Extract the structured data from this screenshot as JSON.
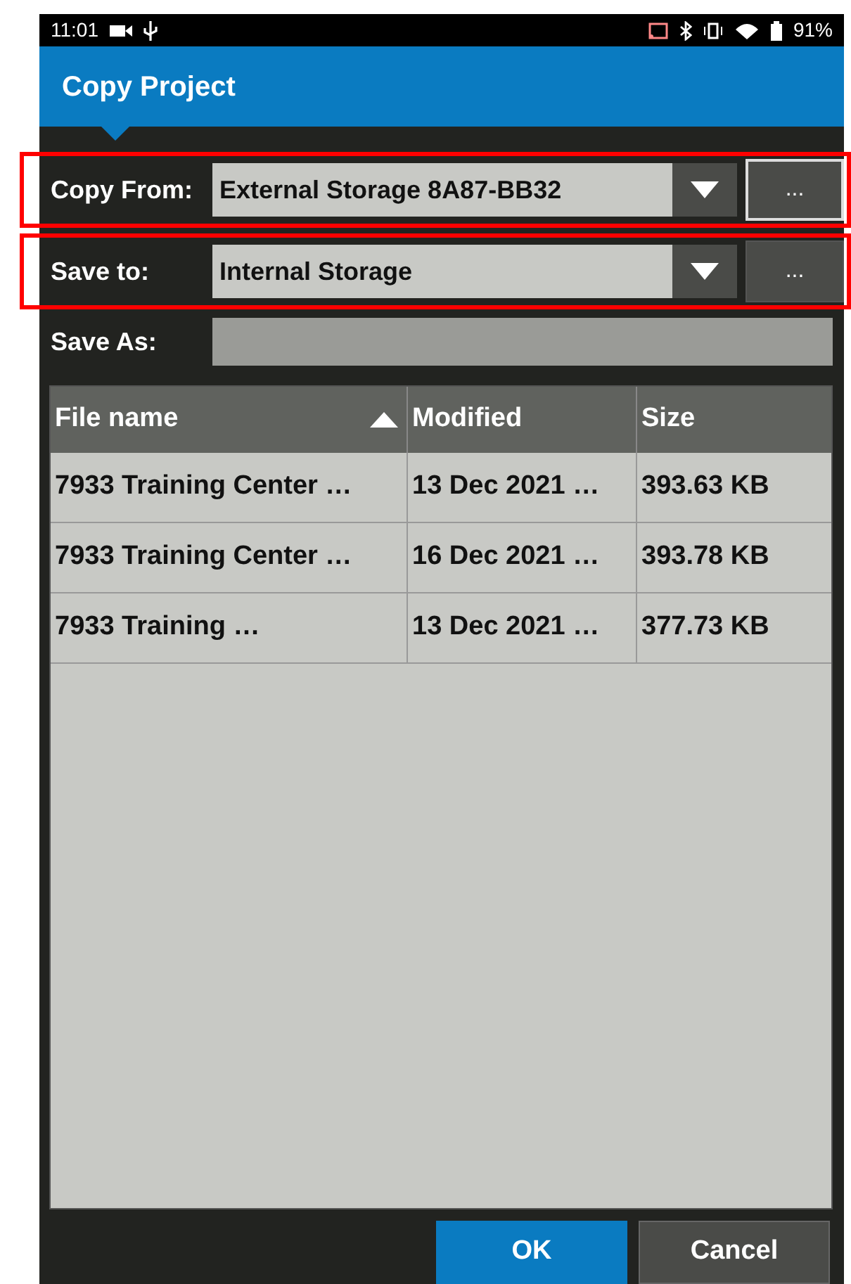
{
  "status_bar": {
    "time": "11:01",
    "battery": "91%"
  },
  "title": "Copy Project",
  "fields": [
    {
      "kind": "dropdown",
      "label": "Copy From:",
      "value": "External Storage 8A87-BB32",
      "browse": "...",
      "highlighted": true,
      "focused": true
    },
    {
      "kind": "dropdown",
      "label": "Save to:",
      "value": "Internal Storage",
      "browse": "...",
      "highlighted": true,
      "focused": false
    },
    {
      "kind": "text",
      "label": "Save As:"
    }
  ],
  "table": {
    "columns": [
      {
        "label": "File name",
        "sort_ascending": true
      },
      {
        "label": "Modified",
        "sort_ascending": false
      },
      {
        "label": "Size",
        "sort_ascending": false
      }
    ],
    "rows": [
      [
        "7933 Training Center …",
        "13 Dec 2021 …",
        "393.63 KB"
      ],
      [
        "7933 Training Center …",
        "16 Dec 2021 …",
        "393.78 KB"
      ],
      [
        "7933 Training …",
        "13 Dec 2021 …",
        "377.73 KB"
      ]
    ]
  },
  "buttons": [
    {
      "label": "OK",
      "kind": "primary"
    },
    {
      "label": "Cancel",
      "kind": "secondary"
    }
  ]
}
